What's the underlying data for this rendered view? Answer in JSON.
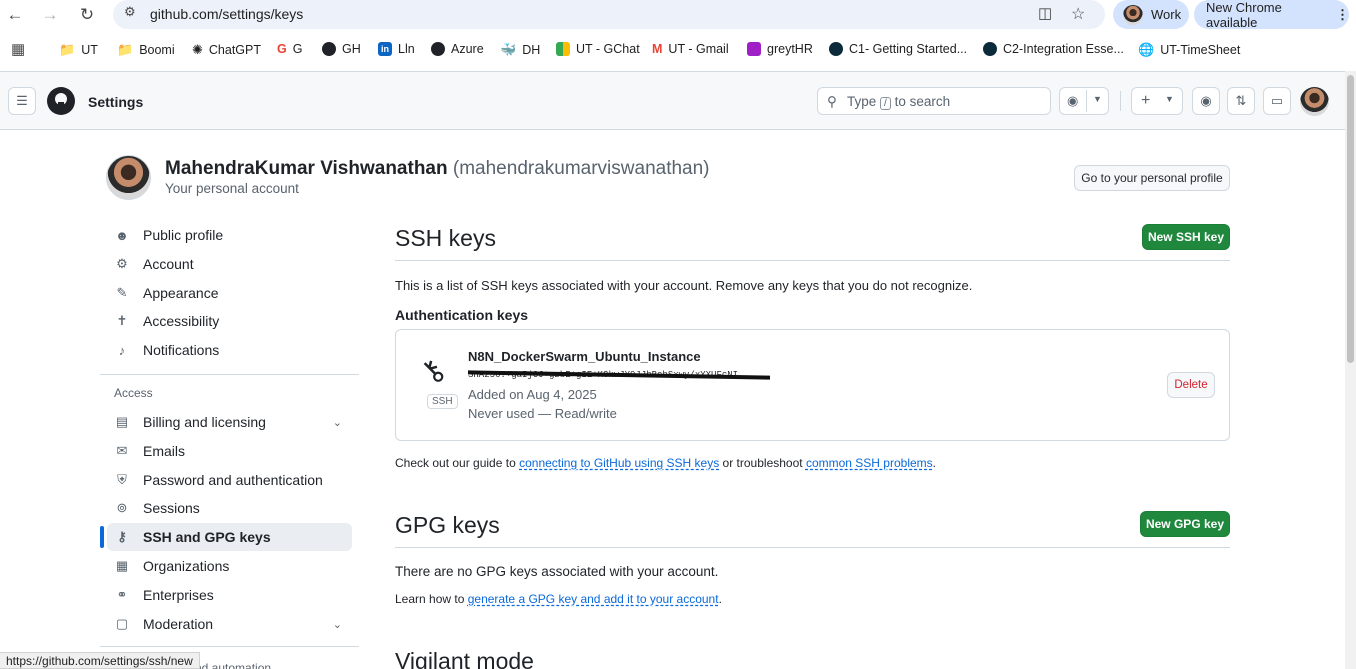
{
  "browser": {
    "url": "github.com/settings/keys",
    "profile_label": "Work",
    "update_label": "New Chrome available"
  },
  "bookmarks": [
    "UT",
    "Boomi",
    "ChatGPT",
    "G",
    "GH",
    "Lln",
    "Azure",
    "DH",
    "UT - GChat",
    "UT - Gmail",
    "greytHR",
    "C1- Getting Started...",
    "C2-Integration Esse...",
    "UT-TimeSheet"
  ],
  "header": {
    "title": "Settings",
    "search_prefix": "Type",
    "search_key": "/",
    "search_suffix": "to search"
  },
  "profile": {
    "name": "MahendraKumar Vishwanathan",
    "handle": "(mahendrakumarviswanathan)",
    "subtitle": "Your personal account",
    "profile_button": "Go to your personal profile"
  },
  "sidebar": {
    "top_items": [
      {
        "label": "Public profile",
        "icon": "person-icon"
      },
      {
        "label": "Account",
        "icon": "gear-icon"
      },
      {
        "label": "Appearance",
        "icon": "paintbrush-icon"
      },
      {
        "label": "Accessibility",
        "icon": "accessibility-icon"
      },
      {
        "label": "Notifications",
        "icon": "bell-icon"
      }
    ],
    "access_heading": "Access",
    "access_items": [
      {
        "label": "Billing and licensing",
        "icon": "credit-card-icon"
      },
      {
        "label": "Emails",
        "icon": "mail-icon"
      },
      {
        "label": "Password and authentication",
        "icon": "shield-lock-icon"
      },
      {
        "label": "Sessions",
        "icon": "broadcast-icon"
      },
      {
        "label": "SSH and GPG keys",
        "icon": "key-icon"
      },
      {
        "label": "Organizations",
        "icon": "organization-icon"
      },
      {
        "label": "Enterprises",
        "icon": "globe-icon"
      },
      {
        "label": "Moderation",
        "icon": "report-icon"
      }
    ],
    "cut_off_label": "nd automation"
  },
  "ssh": {
    "title": "SSH keys",
    "new_button": "New SSH key",
    "description": "This is a list of SSH keys associated with your account. Remove any keys that you do not recognize.",
    "auth_heading": "Authentication keys",
    "key": {
      "name": "N8N_DockerSwarm_Ubuntu_Instance",
      "fingerprint": "SHA256:+gaIjCJ+gzbE+gIE+KCkwJY9JJhBchSxwy/xYXUFcNI",
      "badge": "SSH",
      "added": "Added on Aug 4, 2025",
      "usage": "Never used — Read/write",
      "delete_button": "Delete"
    },
    "guide_prefix": "Check out our guide to",
    "guide_link": "connecting to GitHub using SSH keys",
    "guide_middle": "or troubleshoot",
    "guide_link2": "common SSH problems",
    "guide_suffix": "."
  },
  "gpg": {
    "title": "GPG keys",
    "new_button": "New GPG key",
    "empty_text": "There are no GPG keys associated with your account.",
    "learn_prefix": "Learn how to",
    "learn_link": "generate a GPG key and add it to your account",
    "learn_suffix": "."
  },
  "vigilant": {
    "title": "Vigilant mode"
  },
  "status_url": "https://github.com/settings/ssh/new"
}
